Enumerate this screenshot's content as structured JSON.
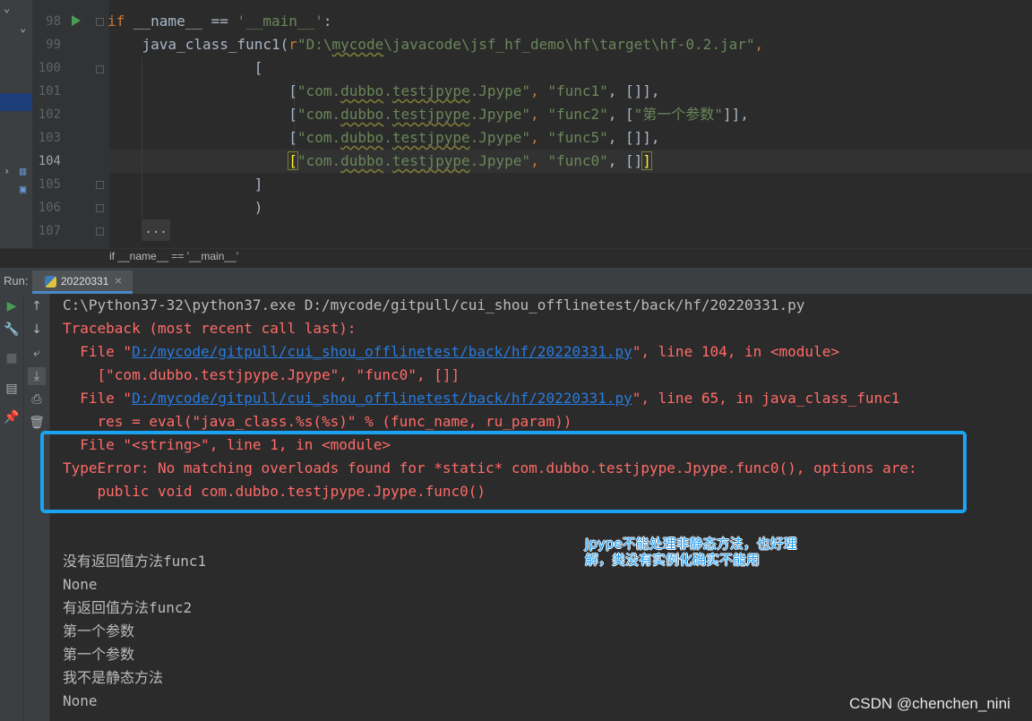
{
  "editor": {
    "line_numbers": [
      "98",
      "99",
      "100",
      "101",
      "102",
      "103",
      "104",
      "105",
      "106",
      "107"
    ],
    "current_line": "104",
    "code": {
      "l98": {
        "kw": "if",
        "text": " __name__ == ",
        "str": "'__main__'",
        "tail": ":"
      },
      "l99": {
        "indent": "    ",
        "func": "java_class_func1(",
        "prefix": "r",
        "path_a": "\"D:\\",
        "path_sq": "mycode",
        "path_b": "\\javacode\\jsf_hf_demo\\hf\\target\\hf-0.2.jar\"",
        "tail": ","
      },
      "l100": {
        "text": "                 ["
      },
      "l101": {
        "indent": "                     [",
        "s1": "\"com.",
        "sq1": "dubbo",
        "s1b": ".",
        "sq2": "testjpype",
        "s1c": ".Jpype\"",
        "c1": ", ",
        "s2": "\"func1\"",
        "rest": ", []],"
      },
      "l102": {
        "indent": "                     [",
        "s1": "\"com.",
        "sq1": "dubbo",
        "s1b": ".",
        "sq2": "testjpype",
        "s1c": ".Jpype\"",
        "c1": ", ",
        "s2": "\"func2\"",
        "mid": ", [",
        "s3": "\"第一个参数\"",
        "rest": "]],"
      },
      "l103": {
        "indent": "                     [",
        "s1": "\"com.",
        "sq1": "dubbo",
        "s1b": ".",
        "sq2": "testjpype",
        "s1c": ".Jpype\"",
        "c1": ", ",
        "s2": "\"func5\"",
        "rest": ", []],"
      },
      "l104": {
        "indent": "                     ",
        "open": "[",
        "s1": "\"com.",
        "sq1": "dubbo",
        "s1b": ".",
        "sq2": "testjpype",
        "s1c": ".Jpype\"",
        "c1": ", ",
        "s2": "\"func0\"",
        "rest": ", []",
        "close": "]"
      },
      "l105": {
        "text": "                 ]"
      },
      "l106": {
        "text": "                 )"
      },
      "l107": {
        "collapsed": "..."
      }
    }
  },
  "breadcrumb": "if __name__ == '__main__'",
  "run_panel": {
    "label": "Run:",
    "tab_label": "20220331",
    "tab_close": "×"
  },
  "console": {
    "cmd": "C:\\Python37-32\\python37.exe D:/mycode/gitpull/cui_shou_offlinetest/back/hf/20220331.py",
    "traceback": "Traceback (most recent call last):",
    "file1_prefix": "  File \"",
    "file1_link": "D:/mycode/gitpull/cui_shou_offlinetest/back/hf/20220331.py",
    "file1_suffix": "\", line 104, in <module>",
    "code1": "    [\"com.dubbo.testjpype.Jpype\", \"func0\", []]",
    "file2_prefix": "  File \"",
    "file2_link": "D:/mycode/gitpull/cui_shou_offlinetest/back/hf/20220331.py",
    "file2_suffix": "\", line 65, in java_class_func1",
    "code2": "    res = eval(\"java_class.%s(%s)\" % (func_name, ru_param))",
    "file3": "  File \"<string>\", line 1, in <module>",
    "type_error": "TypeError: No matching overloads found for *static* com.dubbo.testjpype.Jpype.func0(), options are:",
    "overload": "    public void com.dubbo.testjpype.Jpype.func0()",
    "stdout": [
      "没有返回值方法func1",
      "None",
      "有返回值方法func2",
      "第一个参数",
      "第一个参数",
      "我不是静态方法",
      "None"
    ]
  },
  "annotation": {
    "line1": "Jpype不能处理非静态方法，也好理",
    "line2": "解，类没有实例化确实不能用"
  },
  "watermark": "CSDN @chenchen_nini",
  "colors": {
    "highlight_box": "#1aa3f2",
    "error_text": "#ff6b68",
    "link": "#287bde",
    "keyword": "#cc7832",
    "string": "#6a8759"
  }
}
